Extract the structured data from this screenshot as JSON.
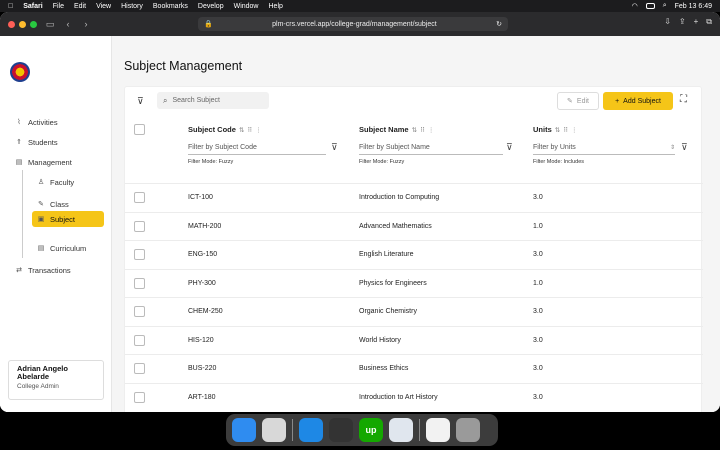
{
  "menubar": {
    "apple": "",
    "items": [
      "Safari",
      "File",
      "Edit",
      "View",
      "History",
      "Bookmarks",
      "Develop",
      "Window",
      "Help"
    ],
    "datetime": "Feb 13  6:49"
  },
  "browser": {
    "url": "plm-crs.vercel.app/college-grad/management/subject"
  },
  "sidebar": {
    "items": [
      {
        "label": "Activities",
        "icon": "⌇"
      },
      {
        "label": "Students",
        "icon": "⇑"
      },
      {
        "label": "Management",
        "icon": "▤"
      },
      {
        "label": "Faculty",
        "icon": "♙"
      },
      {
        "label": "Class",
        "icon": "✎"
      },
      {
        "label": "Subject",
        "icon": "▣"
      },
      {
        "label": "Curriculum",
        "icon": "▤"
      },
      {
        "label": "Transactions",
        "icon": "⇄"
      }
    ],
    "user": {
      "name": "Adrian Angelo Abelarde",
      "role": "College Admin"
    }
  },
  "page": {
    "title": "Subject Management",
    "search_placeholder": "Search Subject",
    "edit_label": "Edit",
    "add_label": "Add Subject"
  },
  "table": {
    "columns": [
      {
        "label": "Subject Code",
        "filter_placeholder": "Filter by Subject Code",
        "filter_mode": "Filter Mode: Fuzzy"
      },
      {
        "label": "Subject Name",
        "filter_placeholder": "Filter by Subject Name",
        "filter_mode": "Filter Mode: Fuzzy"
      },
      {
        "label": "Units",
        "filter_placeholder": "Filter by Units",
        "filter_mode": "Filter Mode: Includes"
      }
    ],
    "rows": [
      {
        "code": "ICT-100",
        "name": "Introduction to Computing",
        "units": "3.0"
      },
      {
        "code": "MATH-200",
        "name": "Advanced Mathematics",
        "units": "1.0"
      },
      {
        "code": "ENG-150",
        "name": "English Literature",
        "units": "3.0"
      },
      {
        "code": "PHY-300",
        "name": "Physics for Engineers",
        "units": "1.0"
      },
      {
        "code": "CHEM-250",
        "name": "Organic Chemistry",
        "units": "3.0"
      },
      {
        "code": "HIS-120",
        "name": "World History",
        "units": "3.0"
      },
      {
        "code": "BUS-220",
        "name": "Business Ethics",
        "units": "3.0"
      },
      {
        "code": "ART-180",
        "name": "Introduction to Art History",
        "units": "3.0"
      }
    ]
  },
  "dock": {
    "apps": [
      {
        "name": "finder-icon",
        "color": "#2f8cf0"
      },
      {
        "name": "launchpad-icon",
        "color": "#d8d8d8"
      },
      {
        "name": "safari-icon",
        "color": "#1e88e5"
      },
      {
        "name": "figma-icon",
        "color": "#333333"
      },
      {
        "name": "upwork-icon",
        "color": "#14a800",
        "text": "up"
      },
      {
        "name": "preview-icon",
        "color": "#e0e6ee"
      },
      {
        "name": "document-icon",
        "color": "#f2f2f2"
      },
      {
        "name": "trash-icon",
        "color": "#9a9a9a"
      }
    ]
  }
}
